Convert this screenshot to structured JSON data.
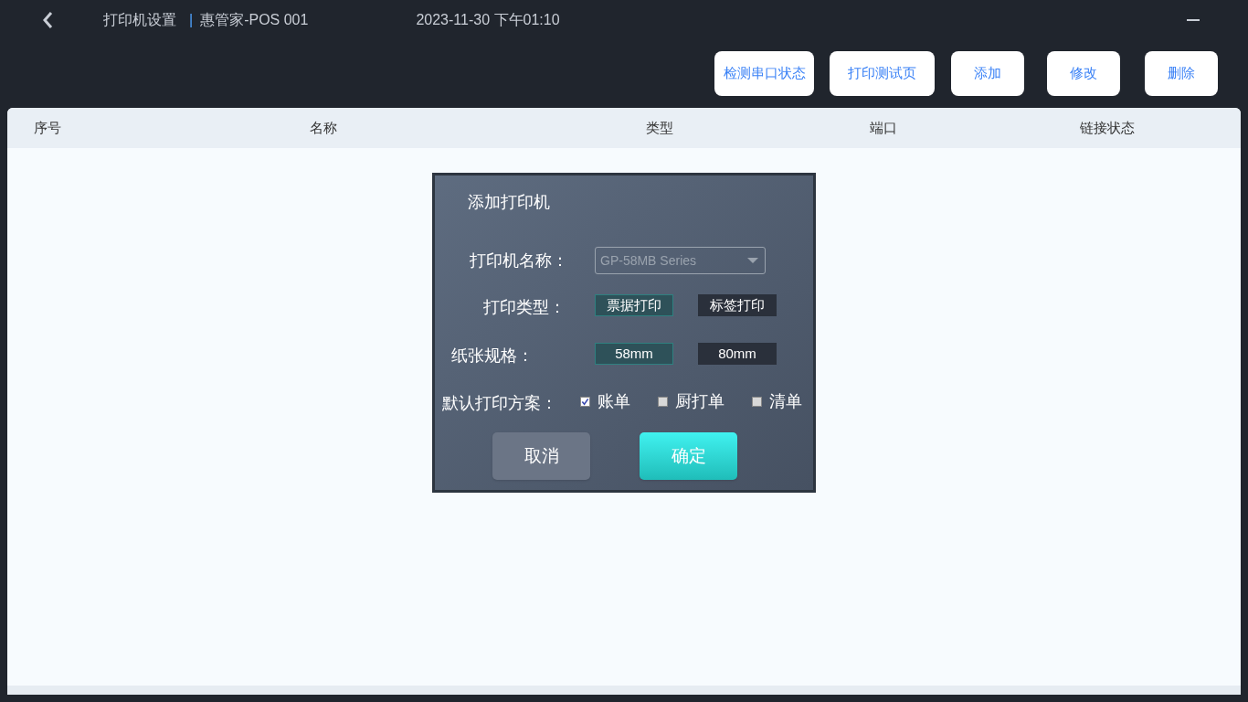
{
  "header": {
    "title": "打印机设置",
    "separator": "|",
    "store": "惠管家-POS 001",
    "datetime": "2023-11-30 下午01:10"
  },
  "toolbar": [
    "检测串口状态",
    "打印测试页",
    "添加",
    "修改",
    "删除"
  ],
  "table": {
    "columns": [
      "序号",
      "名称",
      "类型",
      "端口",
      "链接状态"
    ]
  },
  "dialog": {
    "title": "添加打印机",
    "printer_name": {
      "label": "打印机名称：",
      "value": "GP-58MB Series"
    },
    "print_type": {
      "label": "打印类型：",
      "options": [
        {
          "label": "票据打印",
          "selected": true
        },
        {
          "label": "标签打印",
          "selected": false
        }
      ]
    },
    "paper": {
      "label": "纸张规格：",
      "options": [
        {
          "label": "58mm",
          "selected": true
        },
        {
          "label": "80mm",
          "selected": false
        }
      ]
    },
    "plan": {
      "label": "默认打印方案：",
      "options": [
        {
          "label": "账单",
          "checked": true
        },
        {
          "label": "厨打单",
          "checked": false
        },
        {
          "label": "清单",
          "checked": false
        }
      ]
    },
    "buttons": [
      {
        "label": "取消",
        "kind": "cancel"
      },
      {
        "label": "确定",
        "kind": "confirm"
      }
    ]
  }
}
